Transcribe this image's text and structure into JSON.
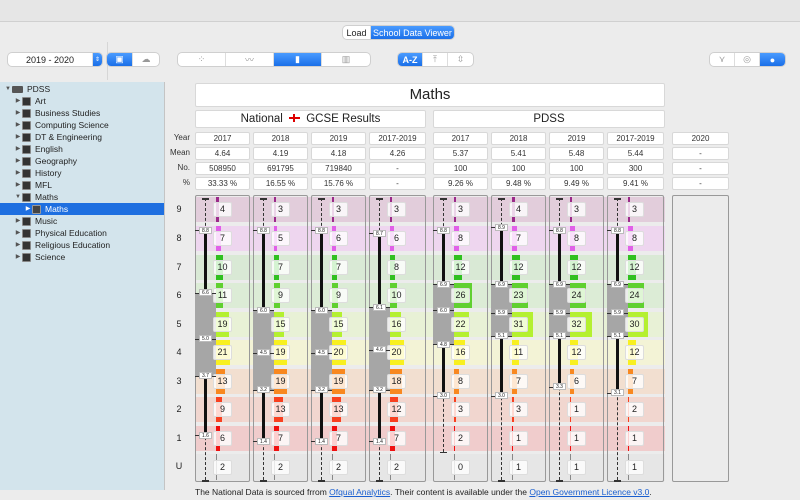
{
  "top_tabs": [
    {
      "label": "Load",
      "active": false
    },
    {
      "label": "School Data Viewer",
      "active": true
    }
  ],
  "toolbar": {
    "year_select": "2019 - 2020",
    "source_toggle": [
      {
        "icon": "school-icon",
        "active": true
      },
      {
        "icon": "cloud-icon",
        "active": false
      }
    ],
    "chart_modes": [
      {
        "icon": "scatter-icon",
        "active": false
      },
      {
        "icon": "line-chart-icon",
        "active": false
      },
      {
        "icon": "box-plot-icon",
        "active": true
      },
      {
        "icon": "bar-grid-icon",
        "active": false
      }
    ],
    "sort_modes": [
      {
        "label": "A-Z",
        "active": true
      },
      {
        "icon": "sort-top-icon",
        "active": false
      },
      {
        "icon": "sort-middle-icon",
        "active": false
      }
    ],
    "view_modes": [
      {
        "icon": "filter-icon",
        "active": false
      },
      {
        "icon": "target-icon",
        "active": false
      },
      {
        "icon": "globe-icon",
        "active": true
      }
    ]
  },
  "sidebar": {
    "root": "PDSS",
    "items": [
      "Art",
      "Business Studies",
      "Computing Science",
      "DT & Engineering",
      "English",
      "Geography",
      "History",
      "MFL",
      "Maths"
    ],
    "selected_child": "Maths",
    "items_after": [
      "Music",
      "Physical Education",
      "Religious Education",
      "Science"
    ]
  },
  "main": {
    "title": "Maths",
    "national_header": "National",
    "national_header_suffix": "GCSE Results",
    "pdss_header": "PDSS",
    "row_labels": [
      "Year",
      "Mean",
      "No.",
      "%"
    ],
    "columns": [
      {
        "year": "2017",
        "mean": "4.64",
        "no": "508950",
        "pct": "33.33 %"
      },
      {
        "year": "2018",
        "mean": "4.19",
        "no": "691795",
        "pct": "16.55 %"
      },
      {
        "year": "2019",
        "mean": "4.18",
        "no": "719840",
        "pct": "15.76 %"
      },
      {
        "year": "2017-2019",
        "mean": "4.26",
        "no": "-",
        "pct": "-"
      },
      {
        "year": "2017",
        "mean": "5.37",
        "no": "100",
        "pct": "9.26 %"
      },
      {
        "year": "2018",
        "mean": "5.41",
        "no": "100",
        "pct": "9.48 %"
      },
      {
        "year": "2019",
        "mean": "5.48",
        "no": "100",
        "pct": "9.49 %"
      },
      {
        "year": "2017-2019",
        "mean": "5.44",
        "no": "300",
        "pct": "9.41 %"
      },
      {
        "year": "2020",
        "mean": "-",
        "no": "-",
        "pct": "-"
      }
    ],
    "grades": [
      "9",
      "8",
      "7",
      "6",
      "5",
      "4",
      "3",
      "2",
      "1",
      "U"
    ]
  },
  "chart_data": {
    "type": "box-plot-with-histogram",
    "grades": [
      "9",
      "8",
      "7",
      "6",
      "5",
      "4",
      "3",
      "2",
      "1",
      "U"
    ],
    "band_colors": [
      "#e2cddb",
      "#eed6ef",
      "#d9e9d5",
      "#dcecd6",
      "#e8f1d6",
      "#f3f3d6",
      "#f2dfd0",
      "#f1d6cf",
      "#f0cccc",
      "#e6e6e6"
    ],
    "bar_colors": [
      "#9b2a8a",
      "#e060e8",
      "#30c020",
      "#60d030",
      "#b4f030",
      "#f8f020",
      "#f88820",
      "#f84020",
      "#f01010",
      "#888888"
    ],
    "series": [
      {
        "counts": [
          4,
          7,
          10,
          11,
          19,
          21,
          13,
          9,
          6,
          2
        ],
        "stats": [
          8.8,
          6.6,
          5.0,
          3.7,
          1.6
        ],
        "min": 0
      },
      {
        "counts": [
          3,
          5,
          7,
          9,
          15,
          19,
          19,
          13,
          7,
          2
        ],
        "stats": [
          8.8,
          6.0,
          4.5,
          3.2,
          1.4
        ],
        "min": 0
      },
      {
        "counts": [
          3,
          6,
          7,
          9,
          15,
          20,
          19,
          13,
          7,
          2
        ],
        "stats": [
          8.8,
          6.0,
          4.5,
          3.2,
          1.4
        ],
        "min": 0
      },
      {
        "counts": [
          3,
          6,
          8,
          10,
          16,
          20,
          18,
          12,
          7,
          2
        ],
        "stats": [
          8.7,
          6.1,
          4.6,
          3.2,
          1.4
        ],
        "min": 0
      },
      {
        "counts": [
          3,
          8,
          12,
          26,
          22,
          16,
          8,
          3,
          2,
          0
        ],
        "stats": [
          8.8,
          6.9,
          6.0,
          4.8,
          3.0
        ],
        "min": 1
      },
      {
        "counts": [
          4,
          7,
          12,
          23,
          31,
          11,
          7,
          3,
          1,
          1
        ],
        "stats": [
          8.9,
          6.9,
          5.9,
          5.1,
          3.0
        ],
        "min": 0
      },
      {
        "counts": [
          3,
          8,
          12,
          24,
          32,
          12,
          6,
          1,
          1,
          1
        ],
        "stats": [
          8.8,
          6.9,
          5.9,
          5.1,
          3.3
        ],
        "min": 0
      },
      {
        "counts": [
          3,
          8,
          12,
          24,
          30,
          12,
          7,
          2,
          1,
          1
        ],
        "stats": [
          8.8,
          6.9,
          5.9,
          5.1,
          3.1
        ],
        "min": 0
      }
    ]
  },
  "footer": {
    "text1": "The National Data is sourced frrom ",
    "link1": "Ofqual Analytics",
    "text2": ".  Their content is available under the ",
    "link2": "Open Government Licence v3.0",
    "text3": "."
  }
}
